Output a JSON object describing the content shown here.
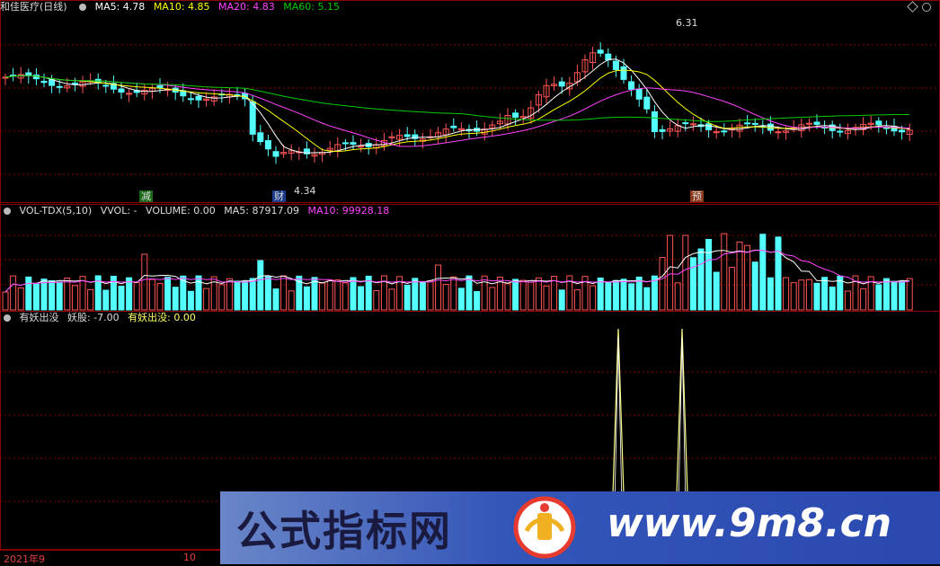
{
  "main_header": {
    "stock": "和佳医疗(日线)",
    "ma5": "MA5: 4.78",
    "ma10": "MA10: 4.85",
    "ma20": "MA20: 4.83",
    "ma60": "MA60: 5.15"
  },
  "vol_header": {
    "name": "VOL-TDX(5,10)",
    "vvol": "VVOL: -",
    "volume": "VOLUME: 0.00",
    "ma5": "MA5: 87917.09",
    "ma10": "MA10: 99928.18"
  },
  "ind_header": {
    "name": "有妖出没",
    "yaogu": "妖股: -7.00",
    "youyao": "有妖出没: 0.00"
  },
  "annotations": {
    "high_price": "6.31",
    "low_price": "4.34",
    "mark_jian": "减",
    "mark_cai": "财",
    "mark_yu": "预"
  },
  "xaxis": {
    "label1": "2021年9",
    "label2": "10"
  },
  "watermark": {
    "left_text": "公式指标网",
    "right_text": "www.9m8.cn"
  },
  "colors": {
    "up": "#ff5555",
    "down": "#54ffff",
    "ma5": "#ffffff",
    "ma10": "#ffff00",
    "ma20": "#ff44ff",
    "ma60": "#00cc00",
    "grid": "#8b0000"
  },
  "chart_data": [
    {
      "type": "line",
      "title": "和佳医疗(日线)",
      "series": [
        {
          "name": "MA5",
          "values": [
            4.78
          ]
        },
        {
          "name": "MA10",
          "values": [
            4.85
          ]
        },
        {
          "name": "MA20",
          "values": [
            4.83
          ]
        },
        {
          "name": "MA60",
          "values": [
            5.15
          ]
        }
      ],
      "ylim": [
        4.0,
        6.5
      ],
      "notes_max": 6.31,
      "notes_min": 4.34
    },
    {
      "type": "bar",
      "title": "VOL-TDX(5,10)",
      "series": [
        {
          "name": "MA5",
          "values": [
            87917.09
          ]
        },
        {
          "name": "MA10",
          "values": [
            99928.18
          ]
        }
      ]
    },
    {
      "type": "line",
      "title": "有妖出没",
      "series": [
        {
          "name": "妖股",
          "values": [
            -7.0
          ]
        },
        {
          "name": "有妖出没",
          "values": [
            0.0
          ]
        }
      ]
    }
  ]
}
